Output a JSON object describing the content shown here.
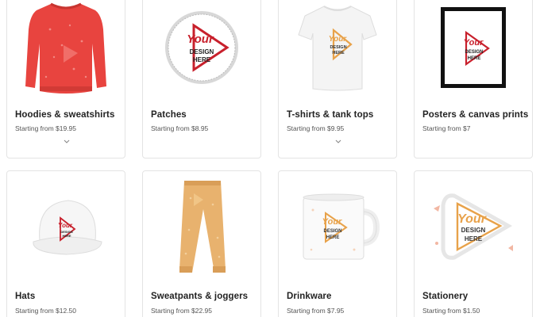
{
  "products": [
    {
      "title": "Hoodies & sweatshirts",
      "price": "Starting from $19.95",
      "has_more": true,
      "image_icon": "sweatshirt-icon"
    },
    {
      "title": "Patches",
      "price": "Starting from $8.95",
      "has_more": false,
      "image_icon": "patch-icon"
    },
    {
      "title": "T-shirts & tank tops",
      "price": "Starting from $9.95",
      "has_more": true,
      "image_icon": "tshirt-icon"
    },
    {
      "title": "Posters & canvas prints",
      "price": "Starting from $7",
      "has_more": false,
      "image_icon": "poster-icon"
    },
    {
      "title": "Hats",
      "price": "Starting from $12.50",
      "has_more": false,
      "image_icon": "hat-icon"
    },
    {
      "title": "Sweatpants & joggers",
      "price": "Starting from $22.95",
      "has_more": false,
      "image_icon": "sweatpants-icon"
    },
    {
      "title": "Drinkware",
      "price": "Starting from $7.95",
      "has_more": false,
      "image_icon": "mug-icon"
    },
    {
      "title": "Stationery",
      "price": "Starting from $1.50",
      "has_more": false,
      "image_icon": "sticker-icon"
    }
  ],
  "placeholder_logo": {
    "line1": "Your",
    "line2": "DESIGN",
    "line3": "HERE"
  },
  "colors": {
    "sweatshirt": "#e8443f",
    "logo_red": "#c8202c",
    "logo_orange": "#e8a24a",
    "sweatpants": "#e8b26e",
    "border": "#e4e4e4"
  }
}
